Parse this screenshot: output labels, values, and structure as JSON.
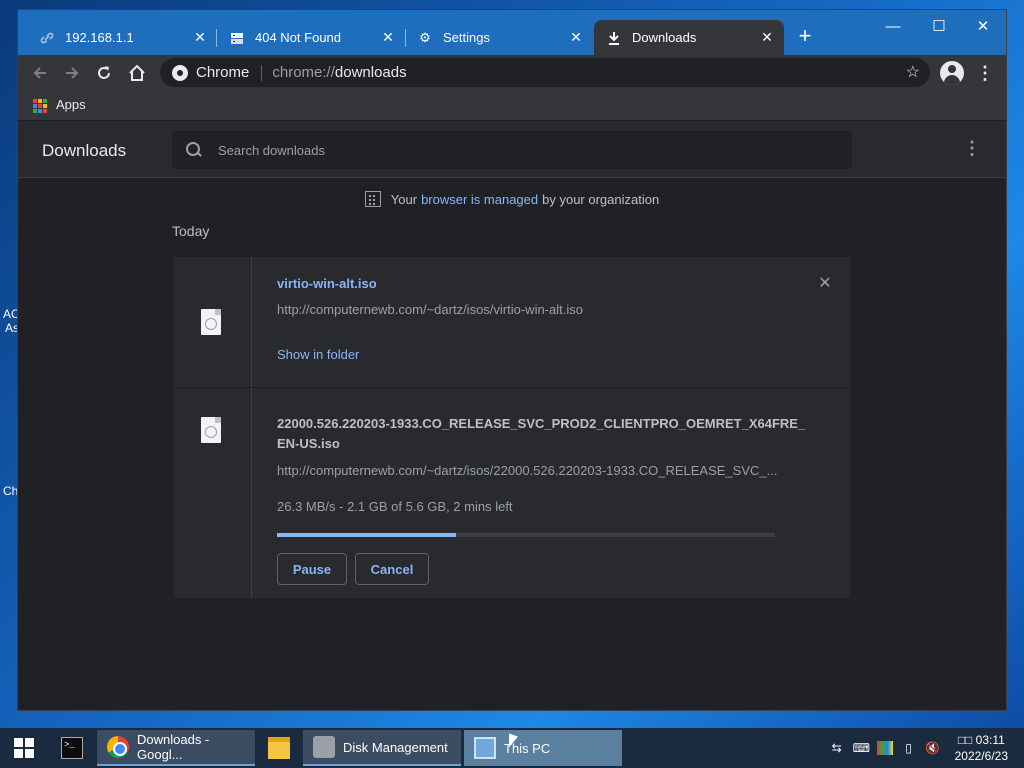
{
  "desktop": {
    "fragments": [
      "AC",
      "As",
      "Ch"
    ]
  },
  "tabs": [
    {
      "title": "192.168.1.1",
      "icon": "link-icon"
    },
    {
      "title": "404 Not Found",
      "icon": "server-icon"
    },
    {
      "title": "Settings",
      "icon": "gear-icon"
    },
    {
      "title": "Downloads",
      "icon": "download-icon"
    }
  ],
  "omnibox": {
    "site": "Chrome",
    "scheme": "chrome://",
    "path": "downloads"
  },
  "bookmarks": {
    "apps_label": "Apps"
  },
  "downloads_page": {
    "title": "Downloads",
    "search_placeholder": "Search downloads",
    "managed_prefix": "Your",
    "managed_link": "browser is managed",
    "managed_suffix": "by your organization",
    "section_label": "Today"
  },
  "items": [
    {
      "filename": "virtio-win-alt.iso",
      "url": "http://computernewb.com/~dartz/isos/virtio-win-alt.iso",
      "action_link": "Show in folder",
      "state": "complete"
    },
    {
      "filename_line1": "22000.526.220203-1933.CO_RELEASE_SVC_PROD2_CLIENTPRO_OEMRET_X64FRE_",
      "filename_line2": "EN-US.iso",
      "url": "http://computernewb.com/~dartz/isos/22000.526.220203-1933.CO_RELEASE_SVC_...",
      "status": "26.3 MB/s - 2.1 GB of 5.6 GB, 2 mins left",
      "progress_fraction": 0.36,
      "pause_label": "Pause",
      "cancel_label": "Cancel",
      "state": "in-progress"
    }
  ],
  "taskbar": {
    "items": [
      {
        "label": "Downloads - Googl...",
        "icon": "chrome-icon"
      },
      {
        "label": "Disk Management",
        "icon": "disk-management-icon"
      },
      {
        "label": "This PC",
        "icon": "this-pc-icon"
      }
    ],
    "clock_time": "□□ 03:11",
    "clock_date": "2022/6/23"
  },
  "colors": {
    "tab_strip": "#1f6dbd",
    "page_bg": "#202124",
    "accent_link": "#8ab4f8",
    "apps_grid": [
      "#ea4335",
      "#fbbc05",
      "#34a853",
      "#4285f4",
      "#ea4335",
      "#fbbc05",
      "#34a853",
      "#4285f4",
      "#ea4335"
    ]
  }
}
